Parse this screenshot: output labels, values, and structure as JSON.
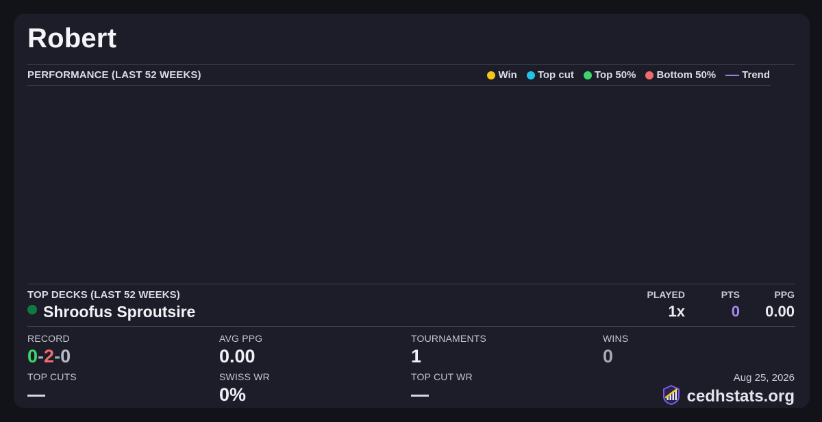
{
  "player": {
    "name": "Robert"
  },
  "performance": {
    "label": "PERFORMANCE (LAST 52 WEEKS)",
    "legend": [
      {
        "label": "Win",
        "color": "#f5c518",
        "kind": "dot"
      },
      {
        "label": "Top cut",
        "color": "#22c4e6",
        "kind": "dot"
      },
      {
        "label": "Top 50%",
        "color": "#3ed66b",
        "kind": "dot"
      },
      {
        "label": "Bottom 50%",
        "color": "#f06b6b",
        "kind": "dot"
      },
      {
        "label": "Trend",
        "color": "#9b7de8",
        "kind": "line"
      }
    ]
  },
  "top_decks": {
    "label": "TOP DECKS (LAST 52 WEEKS)",
    "columns": {
      "played": "PLAYED",
      "pts": "PTS",
      "ppg": "PPG"
    },
    "decks": [
      {
        "name": "Shroofus Sproutsire",
        "color": "#0f7a40",
        "played": "1x",
        "pts": "0",
        "ppg": "0.00"
      }
    ]
  },
  "stats": {
    "record_label": "RECORD",
    "record": {
      "wins": "0",
      "losses": "2",
      "draws": "0",
      "sep": "-"
    },
    "avg_ppg_label": "AVG PPG",
    "avg_ppg": "0.00",
    "tournaments_label": "TOURNAMENTS",
    "tournaments": "1",
    "wins_label": "WINS",
    "wins": "0",
    "top_cuts_label": "TOP CUTS",
    "swiss_wr_label": "SWISS WR",
    "swiss_wr": "0%",
    "top_cut_wr_label": "TOP CUT WR"
  },
  "footer": {
    "date": "Aug 25, 2026",
    "brand": "cedhstats.org"
  },
  "colors": {
    "record_win": "#3ed66b",
    "record_loss": "#f06b6b",
    "record_draw": "#b7bac6",
    "pts": "#a58af0"
  }
}
